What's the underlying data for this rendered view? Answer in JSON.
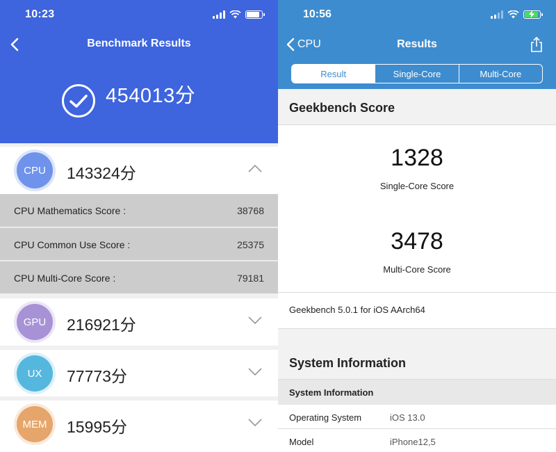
{
  "left": {
    "status_time": "10:23",
    "title": "Benchmark Results",
    "total_score": "454013分",
    "colors": {
      "header": "#3e64de",
      "cpu": "#6f93eb",
      "gpu": "#a892d6",
      "ux": "#56b7de",
      "mem": "#e6a56a"
    },
    "categories": [
      {
        "badge": "CPU",
        "score": "143324分",
        "expanded": true,
        "icon": "chevron-up-icon"
      },
      {
        "badge": "GPU",
        "score": "216921分",
        "expanded": false,
        "icon": "chevron-down-icon"
      },
      {
        "badge": "UX",
        "score": "77773分",
        "expanded": false,
        "icon": "chevron-down-icon"
      },
      {
        "badge": "MEM",
        "score": "15995分",
        "expanded": false,
        "icon": "chevron-down-icon"
      }
    ],
    "cpu_details": [
      {
        "label": "CPU Mathematics Score :",
        "value": "38768"
      },
      {
        "label": "CPU Common Use Score :",
        "value": "25375"
      },
      {
        "label": "CPU Multi-Core Score :",
        "value": "79181"
      }
    ]
  },
  "right": {
    "status_time": "10:56",
    "back_label": "CPU",
    "title": "Results",
    "colors": {
      "header": "#3d8ccf"
    },
    "tabs": [
      "Result",
      "Single-Core",
      "Multi-Core"
    ],
    "active_tab": "Result",
    "score_section": "Geekbench Score",
    "single_core_score": "1328",
    "single_core_label": "Single-Core Score",
    "multi_core_score": "3478",
    "multi_core_label": "Multi-Core Score",
    "version": "Geekbench 5.0.1 for iOS AArch64",
    "system_section": "System Information",
    "system_subheader": "System Information",
    "system_rows": [
      {
        "key": "Operating System",
        "value": "iOS 13.0"
      },
      {
        "key": "Model",
        "value": "iPhone12,5"
      }
    ]
  }
}
